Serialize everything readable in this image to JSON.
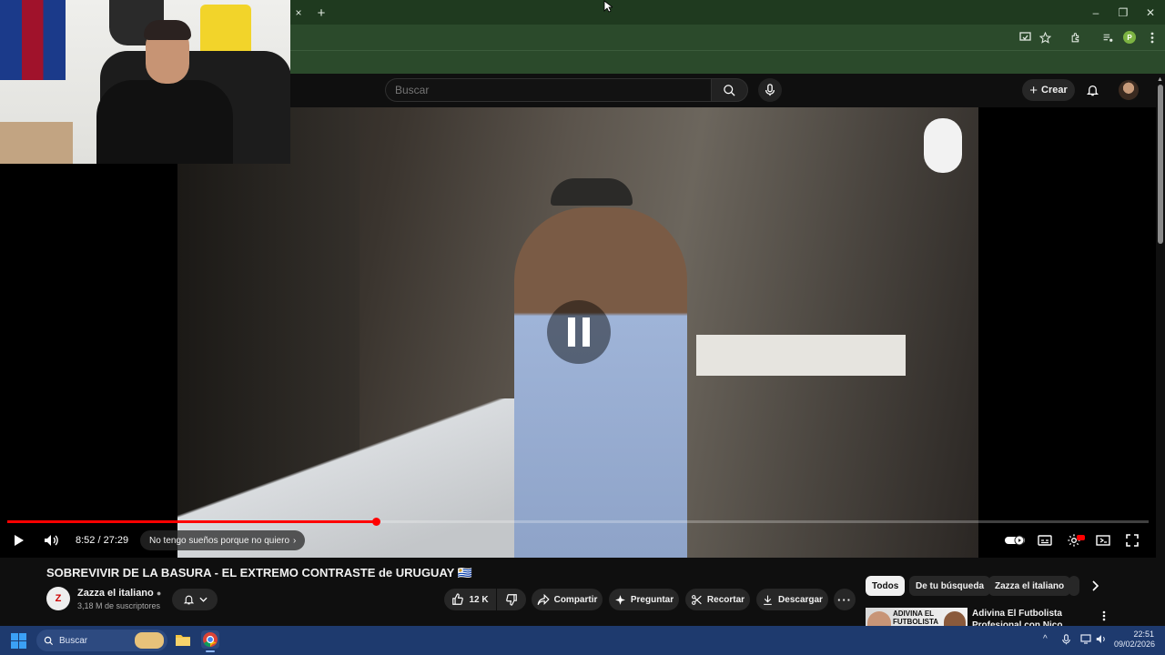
{
  "browser": {
    "tab_close": "×",
    "new_tab": "+",
    "window_controls": [
      "–",
      "❐",
      "✕"
    ],
    "toolbar_icons": [
      "cast-icon",
      "star-icon",
      "extensions-icon",
      "media-icon",
      "profile-icon",
      "menu-icon"
    ],
    "profile_initial": "P"
  },
  "youtube": {
    "search_placeholder": "Buscar",
    "create_label": "Crear"
  },
  "player": {
    "time": "8:52 / 27:29",
    "chapter": "No tengo sueños porque no quiero",
    "progress": 0.3227,
    "buffered": 1.0
  },
  "video": {
    "title": "SOBREVIVIR DE LA BASURA - EL EXTREMO CONTRASTE de URUGUAY 🇺🇾",
    "channel_name": "Zazza el italiano",
    "channel_avatar_text": "Z",
    "subscribers": "3,18 M de suscriptores",
    "likes": "12 K",
    "actions": {
      "share": "Compartir",
      "ask": "Preguntar",
      "clip": "Recortar",
      "download": "Descargar"
    }
  },
  "recommendations": {
    "chips": [
      "Todos",
      "De tu búsqueda",
      "Zazza el italiano"
    ],
    "first": {
      "thumb_text": "ADIVINA EL FUTBOLISTA",
      "title": "Adivina El Futbolista Profesional con Nico Williams"
    }
  },
  "taskbar": {
    "search_label": "Buscar",
    "time": "22:51",
    "date": "09/02/2026"
  },
  "colors": {
    "accent_red": "#ff0000",
    "browser_green": "#2b4a2b",
    "taskbar_blue": "#1e3a6e"
  }
}
